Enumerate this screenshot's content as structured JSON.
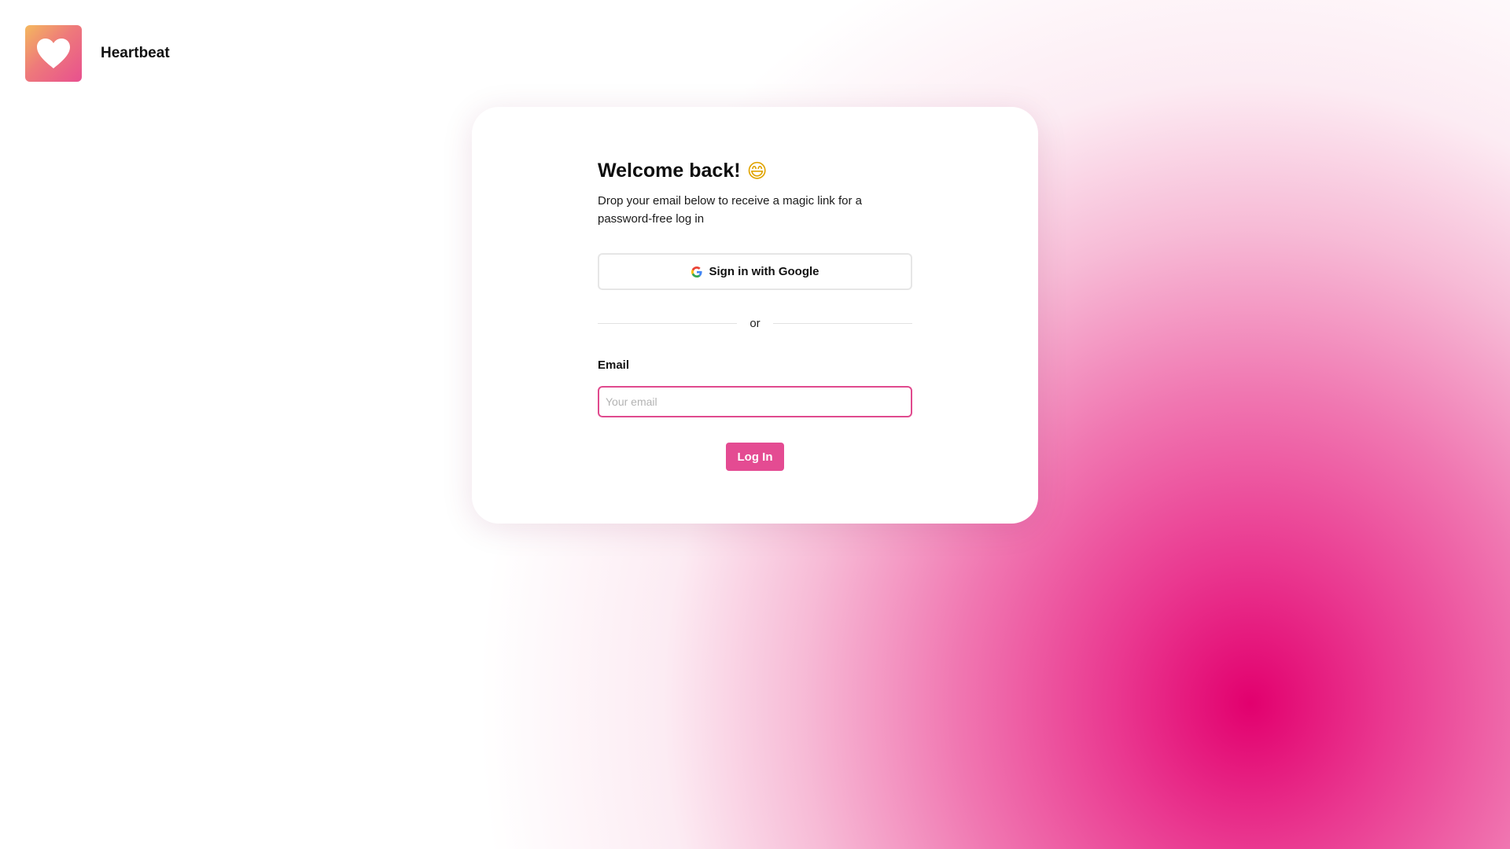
{
  "app": {
    "name": "Heartbeat",
    "logo_icon": "heart-icon"
  },
  "login": {
    "title": "Welcome back!",
    "title_emoji": "😄",
    "subtitle": "Drop your email below to receive a magic link for a password-free log in",
    "google_button_label": "Sign in with Google",
    "google_icon": "google-icon",
    "divider_text": "or",
    "email_label": "Email",
    "email_value": "",
    "email_placeholder": "Your email",
    "submit_label": "Log In"
  },
  "colors": {
    "accent": "#e44b92",
    "input_focus_border": "#e04a8e",
    "background_glow": "#e2006e",
    "logo_gradient_start": "#f4b85e",
    "logo_gradient_end": "#e8508f"
  }
}
